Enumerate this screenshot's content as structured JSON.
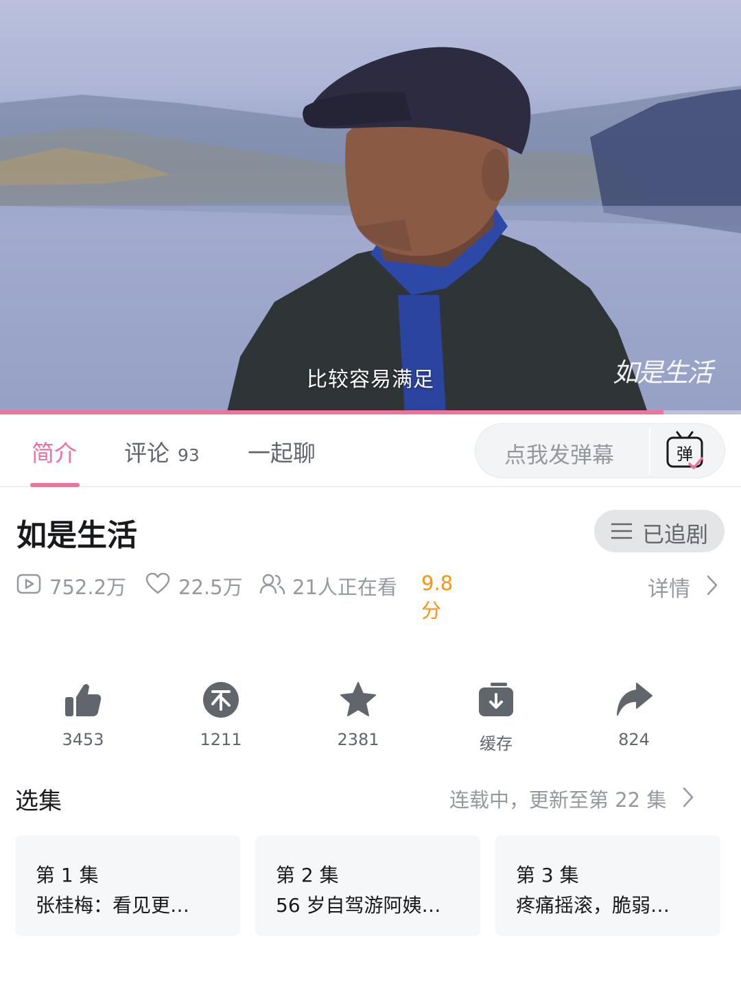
{
  "video": {
    "subtitle": "比较容易满足",
    "watermark": "如是生活",
    "progress_fraction": 0.895
  },
  "tabs": {
    "intro": "简介",
    "comments": "评论",
    "comments_count": "93",
    "chat": "一起聊",
    "danmaku_placeholder": "点我发弹幕",
    "danmaku_icon_char": "弹"
  },
  "show": {
    "title": "如是生活",
    "follow_label": "已追剧"
  },
  "stats": {
    "plays": "752.2万",
    "likes": "22.5万",
    "watching": "21人正在看",
    "rating": "9.8分",
    "details": "详情"
  },
  "actions": [
    {
      "icon": "thumbs-up-icon",
      "value": "3453"
    },
    {
      "icon": "coin-icon",
      "value": "1211"
    },
    {
      "icon": "star-icon",
      "value": "2381"
    },
    {
      "icon": "download-icon",
      "value": "缓存"
    },
    {
      "icon": "share-icon",
      "value": "824"
    }
  ],
  "episodes": {
    "heading": "选集",
    "status": "连载中，更新至第 22 集",
    "items": [
      {
        "number": "第 1 集",
        "name": "张桂梅：看见更…"
      },
      {
        "number": "第 2 集",
        "name": "56 岁自驾游阿姨…"
      },
      {
        "number": "第 3 集",
        "name": "疼痛摇滚，脆弱…"
      }
    ]
  },
  "colors": {
    "accent_pink": "#f1709a",
    "rating_orange": "#ff9212",
    "text_secondary": "#9499a0"
  }
}
